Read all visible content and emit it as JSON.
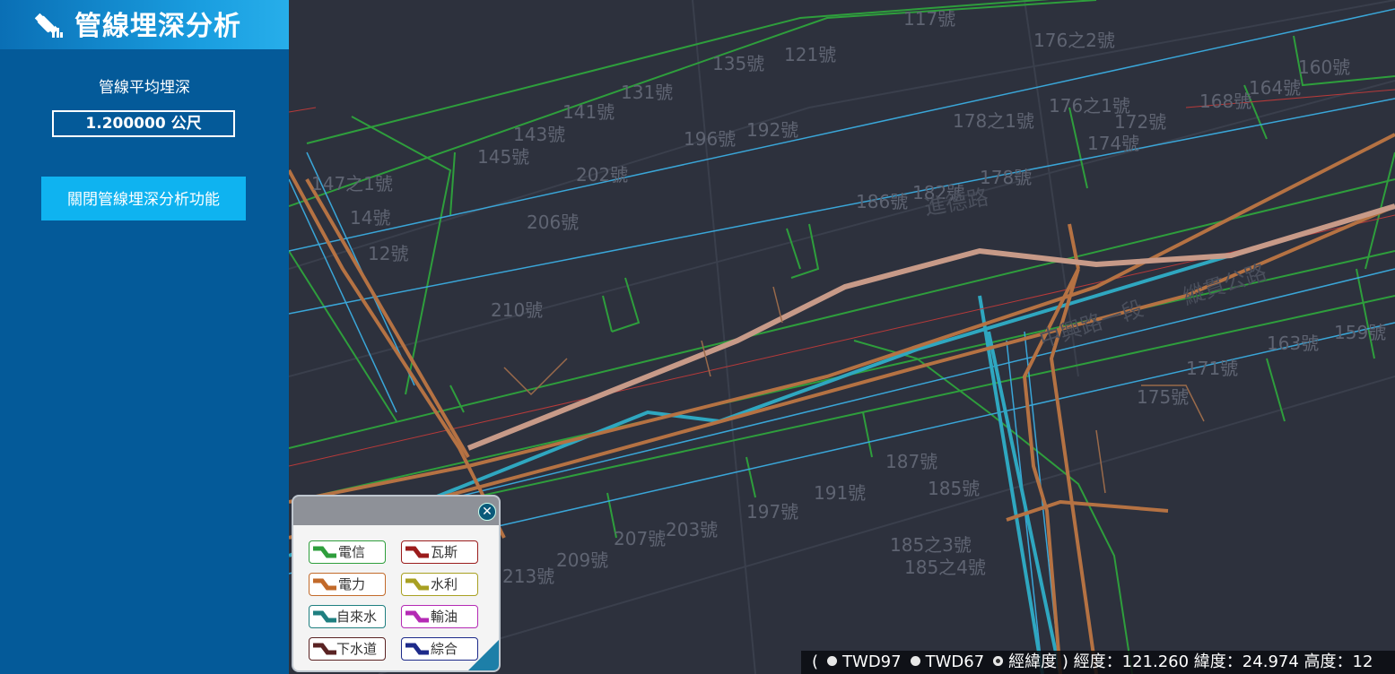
{
  "app": {
    "title": "管線埋深分析"
  },
  "panel": {
    "avg_depth_label": "管線平均埋深",
    "avg_depth_value": "1.200000 公尺",
    "close_button": "關閉管線埋深分析功能"
  },
  "map_labels": [
    "117號",
    "176之2號",
    "135號",
    "121號",
    "160號",
    "131號",
    "164號",
    "168號",
    "141號",
    "176之1號",
    "143號",
    "196號",
    "192號",
    "178之1號",
    "172號",
    "174號",
    "145號",
    "202號",
    "147之1號",
    "178號",
    "186號",
    "182號",
    "14號",
    "206號",
    "12號",
    "210號",
    "163號",
    "159號",
    "171號",
    "175號",
    "187號",
    "191號",
    "185號",
    "197號",
    "207號",
    "203號",
    "209號",
    "185之3號",
    "185之4號",
    "213號"
  ],
  "road_labels": [
    "進德路",
    "中興路一段",
    "縱貫公路"
  ],
  "legend": {
    "items": [
      {
        "label": "電信",
        "color": "#2e9e3c",
        "border": "#2e9e3c"
      },
      {
        "label": "瓦斯",
        "color": "#9b1c1c",
        "border": "#9b1c1c"
      },
      {
        "label": "電力",
        "color": "#c26a2a",
        "border": "#c26a2a"
      },
      {
        "label": "水利",
        "color": "#a8a022",
        "border": "#a8a022"
      },
      {
        "label": "自來水",
        "color": "#1f7f80",
        "border": "#1f7f80"
      },
      {
        "label": "輸油",
        "color": "#b42ab4",
        "border": "#b42ab4"
      },
      {
        "label": "下水道",
        "color": "#5a2323",
        "border": "#5a2323"
      },
      {
        "label": "綜合",
        "color": "#1d2a8a",
        "border": "#1d2a8a"
      }
    ]
  },
  "coords": {
    "open_paren": "(",
    "twd97": "TWD97",
    "twd67": "TWD67",
    "lonlat": "經緯度",
    "close_paren": ")",
    "readout": "經度：121.260 緯度：24.974 高度：12"
  },
  "colors": {
    "sidebar": "#045a99",
    "button": "#0fb3f0",
    "map_bg": "#2d313d"
  }
}
